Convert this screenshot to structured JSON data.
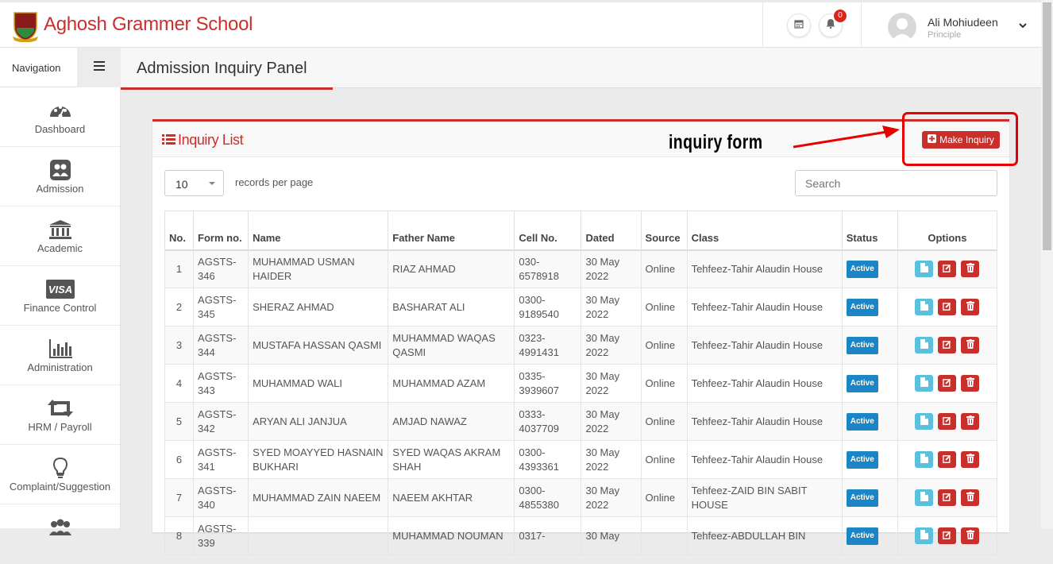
{
  "app": {
    "brand": "Aghosh Grammer School",
    "accent": "#c9302c"
  },
  "header": {
    "notification_count": "0",
    "user_name": "Ali Mohiudeen",
    "user_role": "Principle"
  },
  "sidebar": {
    "title": "Navigation",
    "items": [
      {
        "label": "Dashboard",
        "icon": "dashboard-icon"
      },
      {
        "label": "Admission",
        "icon": "admission-icon"
      },
      {
        "label": "Academic",
        "icon": "academic-icon"
      },
      {
        "label": "Finance Control",
        "icon": "visa-icon"
      },
      {
        "label": "Administration",
        "icon": "bar-chart-icon"
      },
      {
        "label": "HRM / Payroll",
        "icon": "retweet-icon"
      },
      {
        "label": "Complaint/Suggestion",
        "icon": "lightbulb-icon"
      },
      {
        "label": "",
        "icon": "users-icon"
      }
    ]
  },
  "page": {
    "title": "Admission Inquiry Panel"
  },
  "panel": {
    "title": "Inquiry List",
    "annotation": "inquiry form",
    "make_button": "Make Inquiry",
    "page_size": "10",
    "records_label": "records per page",
    "search_placeholder": "Search"
  },
  "table": {
    "headers": {
      "no": "No.",
      "form": "Form no.",
      "name": "Name",
      "father": "Father Name",
      "cell": "Cell No.",
      "dated": "Dated",
      "source": "Source",
      "class": "Class",
      "status": "Status",
      "options": "Options"
    },
    "rows": [
      {
        "no": "1",
        "form": "AGSTS-346",
        "name": "MUHAMMAD USMAN HAIDER",
        "father": "RIAZ AHMAD",
        "cell": "030-6578918",
        "dated": "30 May 2022",
        "source": "Online",
        "class": "Tehfeez-Tahir Alaudin House",
        "status": "Active"
      },
      {
        "no": "2",
        "form": "AGSTS-345",
        "name": "SHERAZ AHMAD",
        "father": "BASHARAT ALI",
        "cell": "0300-9189540",
        "dated": "30 May 2022",
        "source": "Online",
        "class": "Tehfeez-Tahir Alaudin House",
        "status": "Active"
      },
      {
        "no": "3",
        "form": "AGSTS-344",
        "name": "MUSTAFA HASSAN QASMI",
        "father": "MUHAMMAD WAQAS QASMI",
        "cell": "0323-4991431",
        "dated": "30 May 2022",
        "source": "Online",
        "class": "Tehfeez-Tahir Alaudin House",
        "status": "Active"
      },
      {
        "no": "4",
        "form": "AGSTS-343",
        "name": "MUHAMMAD WALI",
        "father": "MUHAMMAD AZAM",
        "cell": "0335-3939607",
        "dated": "30 May 2022",
        "source": "Online",
        "class": "Tehfeez-Tahir Alaudin House",
        "status": "Active"
      },
      {
        "no": "5",
        "form": "AGSTS-342",
        "name": "ARYAN ALI JANJUA",
        "father": "AMJAD NAWAZ",
        "cell": "0333-4037709",
        "dated": "30 May 2022",
        "source": "Online",
        "class": "Tehfeez-Tahir Alaudin House",
        "status": "Active"
      },
      {
        "no": "6",
        "form": "AGSTS-341",
        "name": "SYED MOAYYED HASNAIN BUKHARI",
        "father": "SYED WAQAS AKRAM SHAH",
        "cell": "0300-4393361",
        "dated": "30 May 2022",
        "source": "Online",
        "class": "Tehfeez-Tahir Alaudin House",
        "status": "Active"
      },
      {
        "no": "7",
        "form": "AGSTS-340",
        "name": "MUHAMMAD ZAIN NAEEM",
        "father": "NAEEM AKHTAR",
        "cell": "0300-4855380",
        "dated": "30 May 2022",
        "source": "Online",
        "class": "Tehfeez-ZAID BIN SABIT HOUSE",
        "status": "Active"
      },
      {
        "no": "8",
        "form": "AGSTS-339",
        "name": "",
        "father": "MUHAMMAD NOUMAN",
        "cell": "0317-",
        "dated": "30 May",
        "source": "",
        "class": "Tehfeez-ABDULLAH BIN",
        "status": "Active"
      }
    ]
  }
}
